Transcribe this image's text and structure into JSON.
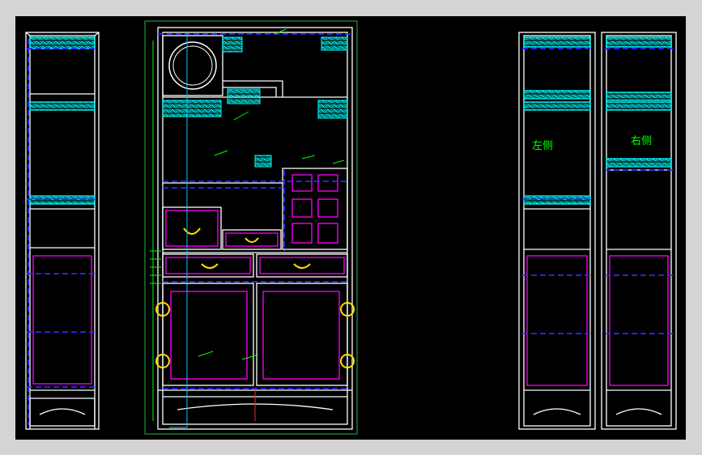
{
  "viewport": {
    "background": "#000000",
    "frame": "#d4d4d4"
  },
  "colors": {
    "outline": "#ffffff",
    "carving": "#00ffff",
    "hidden_line": "#2a2aff",
    "panel": "#ff00ff",
    "handle": "#ffe000",
    "annotation": "#00ff00",
    "frame_line": "#29b34a",
    "axis": "#ff2020"
  },
  "views": {
    "left_view": {
      "label": "左侧"
    },
    "right_view": {
      "label": "右侧"
    },
    "front_view": {
      "round_window": "moon-gate-carving",
      "drawer_handle_icon": "bat-handle-icon",
      "door_hinge_icon": "round-hinge-icon"
    }
  }
}
